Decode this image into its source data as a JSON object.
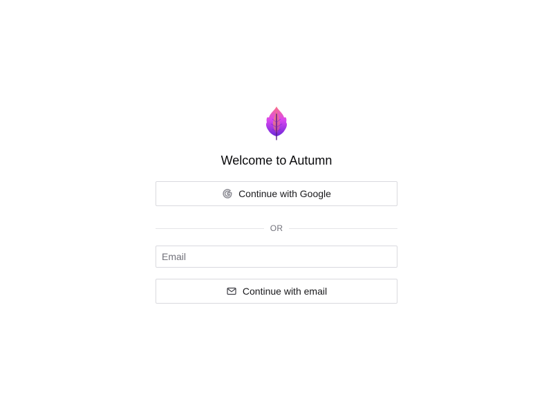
{
  "app": {
    "title": "Welcome to Autumn",
    "logo_icon": "leaf-icon",
    "brand_colors": [
      "#f472b6",
      "#c026d3",
      "#7c3aed",
      "#f59e0b"
    ]
  },
  "auth": {
    "google_button_label": "Continue with Google",
    "google_icon": "google-icon",
    "divider_label": "OR",
    "email_placeholder": "Email",
    "email_value": "",
    "email_button_label": "Continue with email",
    "email_icon": "mail-icon"
  }
}
